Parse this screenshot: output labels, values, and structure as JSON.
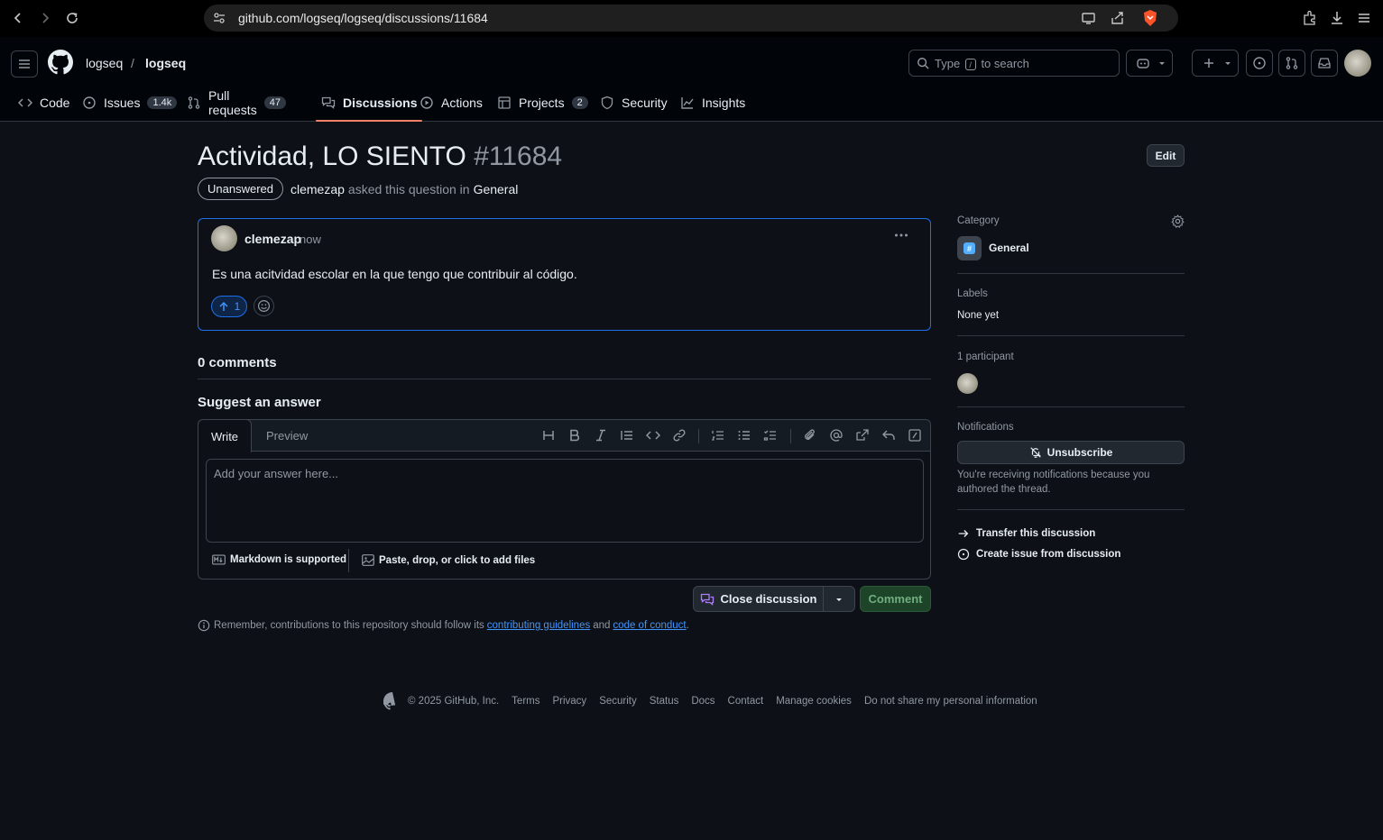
{
  "browser": {
    "url": "github.com/logseq/logseq/discussions/11684"
  },
  "header": {
    "owner": "logseq",
    "separator": "/",
    "repo": "logseq",
    "search_prefix": "Type",
    "search_key": "/",
    "search_suffix": "to search"
  },
  "tabs": [
    {
      "label": "Code",
      "count": "",
      "icon": "code-icon"
    },
    {
      "label": "Issues",
      "count": "1.4k",
      "icon": "issue-icon"
    },
    {
      "label": "Pull requests",
      "count": "47",
      "icon": "pull-request-icon"
    },
    {
      "label": "Discussions",
      "count": "",
      "icon": "discussion-icon"
    },
    {
      "label": "Actions",
      "count": "",
      "icon": "play-icon"
    },
    {
      "label": "Projects",
      "count": "2",
      "icon": "table-icon"
    },
    {
      "label": "Security",
      "count": "",
      "icon": "shield-icon"
    },
    {
      "label": "Insights",
      "count": "",
      "icon": "graph-icon"
    }
  ],
  "discussion": {
    "title": "Actividad, LO SIENTO",
    "number": "#11684",
    "edit_label": "Edit",
    "state": "Unanswered",
    "author": "clemezap",
    "asked_text": "asked this question in",
    "category": "General"
  },
  "post": {
    "author": "clemezap",
    "time": "now",
    "body": "Es una acitvidad escolar en la que tengo que contribuir al código.",
    "upvotes": "1"
  },
  "comments_heading": "0 comments",
  "answer": {
    "heading": "Suggest an answer",
    "write_tab": "Write",
    "preview_tab": "Preview",
    "placeholder": "Add your answer here...",
    "markdown_note": "Markdown is supported",
    "files_note": "Paste, drop, or click to add files",
    "close_label": "Close discussion",
    "comment_label": "Comment",
    "remember_prefix": "Remember, contributions to this repository should follow its",
    "guidelines_link": "contributing guidelines",
    "and_text": "and",
    "conduct_link": "code of conduct",
    "period": "."
  },
  "sidebar": {
    "category_heading": "Category",
    "category_name": "General",
    "labels_heading": "Labels",
    "labels_value": "None yet",
    "participants_heading": "1 participant",
    "notifications_heading": "Notifications",
    "unsubscribe_label": "Unsubscribe",
    "notice": "You're receiving notifications because you authored the thread.",
    "transfer_label": "Transfer this discussion",
    "create_issue_label": "Create issue from discussion"
  },
  "footer": {
    "copyright": "© 2025 GitHub, Inc.",
    "links": [
      "Terms",
      "Privacy",
      "Security",
      "Status",
      "Docs",
      "Contact",
      "Manage cookies",
      "Do not share my personal information"
    ]
  },
  "colors": {
    "background": "#0d1117",
    "header_bg": "#010409",
    "accent_blue": "#1f6feb",
    "tab_underline": "#f78166",
    "comment_green": "#1d4428"
  }
}
